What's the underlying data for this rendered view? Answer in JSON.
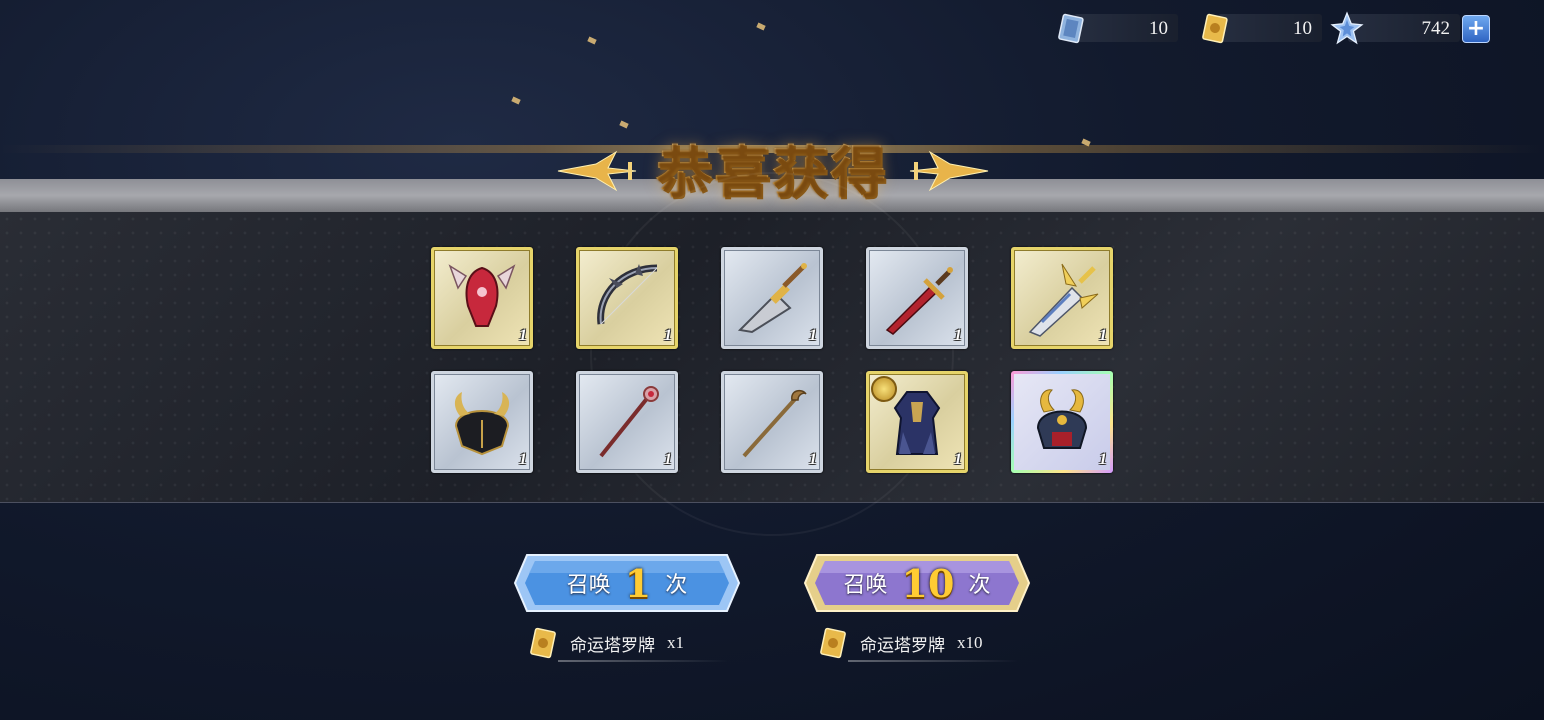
{
  "currencies": [
    {
      "icon": "card-ticket-icon",
      "value": "10"
    },
    {
      "icon": "tarot-ticket-icon",
      "value": "10"
    },
    {
      "icon": "star-crystal-icon",
      "value": "742"
    }
  ],
  "add_button_label": "+",
  "banner": {
    "title": "恭喜获得"
  },
  "items": [
    {
      "name": "dragon-helm-icon",
      "rarity": "gold",
      "count": "1"
    },
    {
      "name": "dark-bow-icon",
      "rarity": "gold",
      "count": "1"
    },
    {
      "name": "golden-cleaver-icon",
      "rarity": "silver",
      "count": "1"
    },
    {
      "name": "crimson-sword-icon",
      "rarity": "silver",
      "count": "1"
    },
    {
      "name": "winged-greatsword-icon",
      "rarity": "gold",
      "count": "1"
    },
    {
      "name": "horned-black-helm-icon",
      "rarity": "silver",
      "count": "1"
    },
    {
      "name": "ruby-staff-icon",
      "rarity": "silver",
      "count": "1"
    },
    {
      "name": "wooden-staff-icon",
      "rarity": "silver",
      "count": "1"
    },
    {
      "name": "navy-robe-armor-icon",
      "rarity": "gold",
      "count": "1"
    },
    {
      "name": "samurai-helm-icon",
      "rarity": "rainbow",
      "count": "1"
    }
  ],
  "summon": [
    {
      "prefix": "召唤",
      "number": "1",
      "suffix": "次",
      "cost_name": "命运塔罗牌",
      "cost_qty": "x1",
      "color": "#5aa2f2"
    },
    {
      "prefix": "召唤",
      "number": "10",
      "suffix": "次",
      "cost_name": "命运塔罗牌",
      "cost_qty": "x10",
      "color": "#9b84d6"
    }
  ],
  "colors": {
    "gold_frame": "#e6d46a",
    "silver_frame": "#cfd6e0",
    "title_gold": "#f6d78a"
  }
}
